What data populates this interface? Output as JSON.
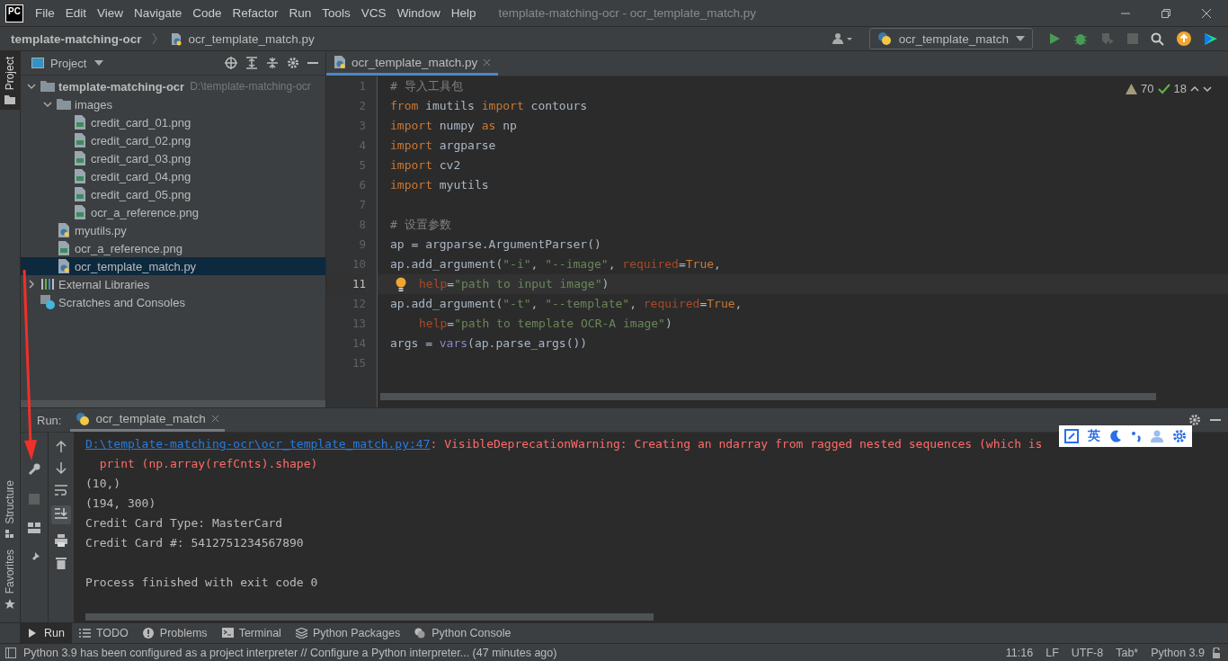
{
  "menu": {
    "logo": "PC",
    "items": [
      "File",
      "Edit",
      "View",
      "Navigate",
      "Code",
      "Refactor",
      "Run",
      "Tools",
      "VCS",
      "Window",
      "Help"
    ],
    "title": "template-matching-ocr - ocr_template_match.py"
  },
  "breadcrumb": {
    "project": "template-matching-ocr",
    "file": "ocr_template_match.py"
  },
  "run_config": "ocr_template_match",
  "left_stripe": {
    "top": [
      {
        "label": "Project",
        "selected": true
      }
    ],
    "bottom": [
      {
        "label": "Structure",
        "selected": false
      },
      {
        "label": "Favorites",
        "selected": false
      }
    ]
  },
  "project_panel": {
    "title": "Project",
    "tree": [
      {
        "name": "template-matching-ocr",
        "path": "D:\\template-matching-ocr",
        "kind": "folder",
        "expanded": true,
        "selected": false,
        "children": [
          {
            "name": "images",
            "kind": "folder",
            "expanded": true,
            "selected": false,
            "children": [
              {
                "name": "credit_card_01.png",
                "kind": "image",
                "selected": false
              },
              {
                "name": "credit_card_02.png",
                "kind": "image",
                "selected": false
              },
              {
                "name": "credit_card_03.png",
                "kind": "image",
                "selected": false
              },
              {
                "name": "credit_card_04.png",
                "kind": "image",
                "selected": false
              },
              {
                "name": "credit_card_05.png",
                "kind": "image",
                "selected": false
              },
              {
                "name": "ocr_a_reference.png",
                "kind": "image",
                "selected": false
              }
            ]
          },
          {
            "name": "myutils.py",
            "kind": "python",
            "selected": false
          },
          {
            "name": "ocr_a_reference.png",
            "kind": "image",
            "selected": false
          },
          {
            "name": "ocr_template_match.py",
            "kind": "python",
            "selected": true
          }
        ]
      },
      {
        "name": "External Libraries",
        "kind": "libraries",
        "expanded": false,
        "selected": false
      },
      {
        "name": "Scratches and Consoles",
        "kind": "scratches",
        "selected": false
      }
    ]
  },
  "editor": {
    "tab": "ocr_template_match.py",
    "warnings": "70",
    "typos": "18",
    "lines": [
      {
        "num": "1",
        "current": false,
        "tokens": [
          {
            "text": "# 导入工具包",
            "kind": "comment"
          }
        ]
      },
      {
        "num": "2",
        "current": false,
        "tokens": [
          {
            "text": "from",
            "kind": "keyword"
          },
          {
            "text": " imutils ",
            "kind": "plain"
          },
          {
            "text": "import",
            "kind": "keyword"
          },
          {
            "text": " contours",
            "kind": "plain"
          }
        ]
      },
      {
        "num": "3",
        "current": false,
        "tokens": [
          {
            "text": "import",
            "kind": "keyword"
          },
          {
            "text": " numpy ",
            "kind": "plain"
          },
          {
            "text": "as",
            "kind": "keyword"
          },
          {
            "text": " np",
            "kind": "plain"
          }
        ]
      },
      {
        "num": "4",
        "current": false,
        "tokens": [
          {
            "text": "import",
            "kind": "keyword"
          },
          {
            "text": " argparse",
            "kind": "plain"
          }
        ]
      },
      {
        "num": "5",
        "current": false,
        "tokens": [
          {
            "text": "import",
            "kind": "keyword"
          },
          {
            "text": " cv2",
            "kind": "plain"
          }
        ]
      },
      {
        "num": "6",
        "current": false,
        "tokens": [
          {
            "text": "import",
            "kind": "keyword"
          },
          {
            "text": " myutils",
            "kind": "plain"
          }
        ]
      },
      {
        "num": "7",
        "current": false
      },
      {
        "num": "8",
        "current": false,
        "tokens": [
          {
            "text": "# 设置参数",
            "kind": "comment"
          }
        ]
      },
      {
        "num": "9",
        "current": false,
        "tokens": [
          {
            "text": "ap = argparse.ArgumentParser()",
            "kind": "plain"
          }
        ]
      },
      {
        "num": "10",
        "current": false,
        "tokens": [
          {
            "text": "ap.add_argument(",
            "kind": "plain"
          },
          {
            "text": "\"-i\"",
            "kind": "string"
          },
          {
            "text": ", ",
            "kind": "plain"
          },
          {
            "text": "\"--image\"",
            "kind": "string"
          },
          {
            "text": ", ",
            "kind": "plain"
          },
          {
            "text": "required",
            "kind": "param"
          },
          {
            "text": "=",
            "kind": "plain"
          },
          {
            "text": "True",
            "kind": "keyword"
          },
          {
            "text": ",",
            "kind": "plain"
          }
        ]
      },
      {
        "num": "11",
        "current": true,
        "bulb": true,
        "indent": true,
        "tokens": [
          {
            "text": "help",
            "kind": "param"
          },
          {
            "text": "=",
            "kind": "plain"
          },
          {
            "text": "\"path to input image\"",
            "kind": "string"
          },
          {
            "text": ")",
            "kind": "plain"
          }
        ]
      },
      {
        "num": "12",
        "current": false,
        "tokens": [
          {
            "text": "ap.add_argument(",
            "kind": "plain"
          },
          {
            "text": "\"-t\"",
            "kind": "string"
          },
          {
            "text": ", ",
            "kind": "plain"
          },
          {
            "text": "\"--template\"",
            "kind": "string"
          },
          {
            "text": ", ",
            "kind": "plain"
          },
          {
            "text": "required",
            "kind": "param"
          },
          {
            "text": "=",
            "kind": "plain"
          },
          {
            "text": "True",
            "kind": "keyword"
          },
          {
            "text": ",",
            "kind": "plain"
          }
        ]
      },
      {
        "num": "13",
        "current": false,
        "indent": true,
        "tokens": [
          {
            "text": "help",
            "kind": "param"
          },
          {
            "text": "=",
            "kind": "plain"
          },
          {
            "text": "\"path to template OCR-A image\"",
            "kind": "string"
          },
          {
            "text": ")",
            "kind": "plain"
          }
        ]
      },
      {
        "num": "14",
        "current": false,
        "tokens": [
          {
            "text": "args = ",
            "kind": "plain"
          },
          {
            "text": "vars",
            "kind": "builtin"
          },
          {
            "text": "(ap.parse_args())",
            "kind": "plain"
          }
        ]
      },
      {
        "num": "15",
        "current": false
      }
    ]
  },
  "run_panel": {
    "label": "Run:",
    "tab": "ocr_template_match",
    "console": [
      {
        "kind": "warning",
        "link": "D:\\template-matching-ocr\\ocr_template_match.py:47",
        "text": ": VisibleDeprecationWarning: Creating an ndarray from ragged nested sequences (which is"
      },
      {
        "kind": "error",
        "text": "  print (np.array(refCnts).shape)"
      },
      {
        "kind": "output",
        "text": "(10,)"
      },
      {
        "kind": "output",
        "text": "(194, 300)"
      },
      {
        "kind": "output",
        "text": "Credit Card Type: MasterCard"
      },
      {
        "kind": "output",
        "text": "Credit Card #: 5412751234567890"
      },
      {
        "kind": "blank"
      },
      {
        "kind": "output",
        "text": "Process finished with exit code 0"
      }
    ]
  },
  "ime_toolbar": {
    "mode": "英"
  },
  "bottom_tabs": [
    {
      "label": "Run",
      "kind": "run",
      "selected": true
    },
    {
      "label": "TODO",
      "kind": "todo",
      "selected": false
    },
    {
      "label": "Problems",
      "kind": "problems",
      "selected": false
    },
    {
      "label": "Terminal",
      "kind": "terminal",
      "selected": false
    },
    {
      "label": "Python Packages",
      "kind": "packages",
      "selected": false
    },
    {
      "label": "Python Console",
      "kind": "console",
      "selected": false
    }
  ],
  "status_bar": {
    "message": "Python 3.9 has been configured as a project interpreter // Configure a Python interpreter... (47 minutes ago)",
    "items": [
      "11:16",
      "LF",
      "UTF-8",
      "Tab*",
      "Python 3.9"
    ]
  }
}
